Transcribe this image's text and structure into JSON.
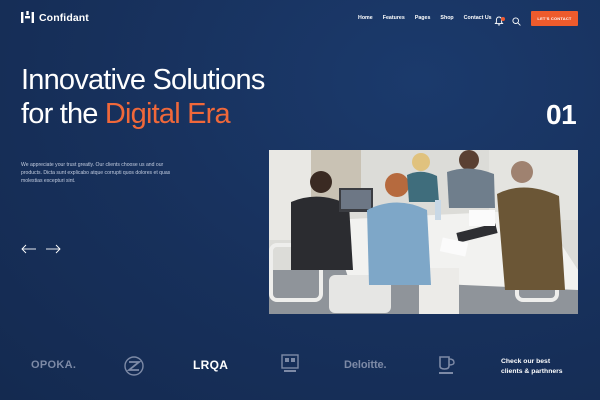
{
  "brand": {
    "name": "Confidant"
  },
  "nav": {
    "items": [
      "Home",
      "Features",
      "Pages",
      "Shop",
      "Contact Us"
    ]
  },
  "header": {
    "cta_label": "LET'S CONTACT"
  },
  "hero": {
    "title_line1": "Innovative Solutions",
    "title_line2_prefix": "for the ",
    "title_line2_accent": "Digital Era",
    "slide_number": "01",
    "description": "We appreciate your trust greatly. Our clients choose us and our products. Dicta sunt explicabo atque corrupti quos dolores et quas molestias excepturi sint."
  },
  "logos": {
    "items": [
      "OPOKA.",
      "LRQA",
      "Deloitte."
    ]
  },
  "clients_link": {
    "line1": "Check our best",
    "line2": "clients & parthners"
  },
  "colors": {
    "background": "#17305b",
    "accent": "#ee5b2c",
    "logo_gray": "#7d8aa6"
  },
  "icons": [
    "bell-icon",
    "search-icon",
    "arrow-left-icon",
    "arrow-right-icon"
  ]
}
